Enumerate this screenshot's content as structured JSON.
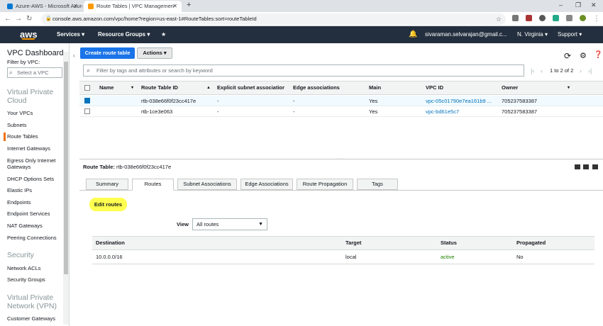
{
  "browser": {
    "tabs": [
      {
        "title": "Azure-AWS - Microsoft Azure",
        "active": false
      },
      {
        "title": "Route Tables | VPC Managemen",
        "active": true
      }
    ],
    "new_tab": "+",
    "url": "console.aws.amazon.com/vpc/home?region=us-east-1#RouteTables:sort=routeTableId",
    "window_controls": [
      "–",
      "❐",
      "✕"
    ]
  },
  "aws_nav": {
    "logo": "aws",
    "services": "Services ▾",
    "resource_groups": "Resource Groups ▾",
    "star": "★",
    "user": "sivaraman.selvarajan@gmail.c...",
    "region": "N. Virginia ▾",
    "support": "Support ▾"
  },
  "sidebar": {
    "title": "VPC Dashboard",
    "filter_label": "Filter by VPC:",
    "vpc_select_placeholder": "Select a VPC",
    "sections": [
      {
        "heading": "Virtual Private Cloud",
        "items": [
          "Your VPCs",
          "Subnets",
          "Route Tables",
          "Internet Gateways",
          "Egress Only Internet Gateways",
          "DHCP Options Sets",
          "Elastic IPs",
          "Endpoints",
          "Endpoint Services",
          "NAT Gateways",
          "Peering Connections"
        ]
      },
      {
        "heading": "Security",
        "items": [
          "Network ACLs",
          "Security Groups"
        ]
      },
      {
        "heading": "Virtual Private Network (VPN)",
        "items": [
          "Customer Gateways"
        ]
      }
    ],
    "selected": "Route Tables"
  },
  "toolbar": {
    "create_label": "Create route table",
    "actions_label": "Actions ▾"
  },
  "filter": {
    "placeholder": "Filter by tags and attributes or search by keyword",
    "pagination": "1 to 2 of 2"
  },
  "table": {
    "columns": [
      "Name",
      "Route Table ID",
      "Explicit subnet associatior",
      "Edge associations",
      "Main",
      "VPC ID",
      "Owner"
    ],
    "rows": [
      {
        "selected": true,
        "name": "",
        "id": "rtb-038e66f0f23cc417e",
        "subnet": "-",
        "edge": "-",
        "main": "Yes",
        "vpc": "vpc-05c01790e7ea161b9 ...",
        "owner": "705237583387"
      },
      {
        "selected": false,
        "name": "",
        "id": "rtb-1ce3e063",
        "subnet": "-",
        "edge": "-",
        "main": "Yes",
        "vpc": "vpc-bd61e5c7",
        "owner": "705237583387"
      }
    ]
  },
  "detail": {
    "label": "Route Table:",
    "id": "rtb-038e66f0f23cc417e",
    "tabs": [
      "Summary",
      "Routes",
      "Subnet Associations",
      "Edge Associations",
      "Route Propagation",
      "Tags"
    ],
    "active_tab": "Routes",
    "edit_routes": "Edit routes",
    "view_label": "View",
    "view_value": "All routes",
    "routes_columns": [
      "Destination",
      "Target",
      "Status",
      "Propagated"
    ],
    "routes": [
      {
        "destination": "10.0.0.0/16",
        "target": "local",
        "status": "active",
        "propagated": "No"
      }
    ]
  },
  "colors": {
    "aws_nav": "#232f3e",
    "primary": "#1a73e8",
    "link": "#0073bb",
    "active_status": "#1d8102",
    "highlight": "#ffff4f"
  }
}
